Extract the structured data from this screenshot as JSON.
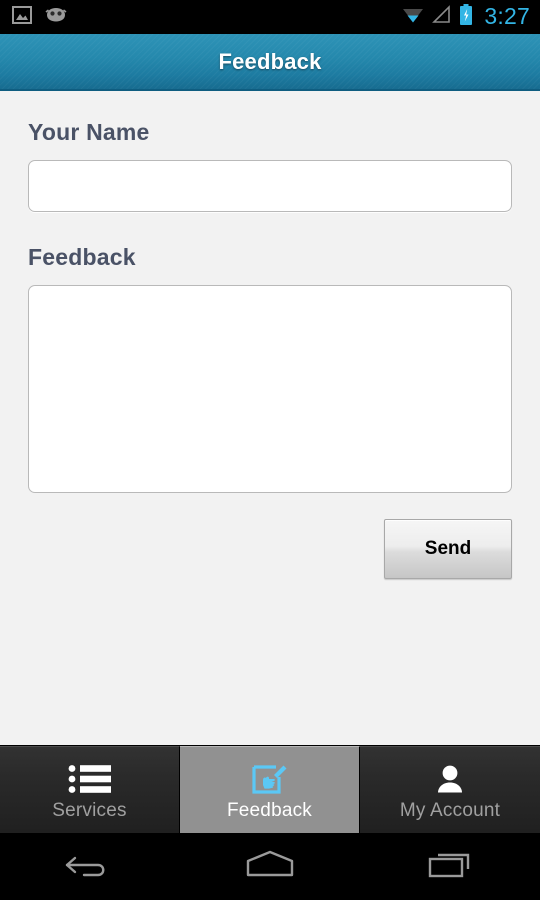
{
  "statusbar": {
    "icons_left": [
      {
        "name": "screenshot-image-icon",
        "label": "screenshot"
      },
      {
        "name": "cyanogenmod-android-icon",
        "label": "cyanogenmod"
      }
    ],
    "icons_right": [
      {
        "name": "wifi-icon",
        "label": "wifi"
      },
      {
        "name": "signal-icon",
        "label": "cellular-signal"
      },
      {
        "name": "battery-charging-icon",
        "label": "battery-charging"
      }
    ],
    "clock": "3:27",
    "clock_color": "#33b5e5"
  },
  "actionbar": {
    "title": "Feedback",
    "background_color": "#2589ad",
    "title_color": "#ffffff"
  },
  "form": {
    "name": {
      "label": "Your Name",
      "value": "",
      "placeholder": ""
    },
    "feedback": {
      "label": "Feedback",
      "value": "",
      "placeholder": ""
    },
    "send_button": {
      "label": "Send"
    },
    "label_color": "#4a5266",
    "field_border_color": "#b9b9b9",
    "page_background": "#f2f2f2"
  },
  "tabbar": {
    "selected_index": 1,
    "selected_background": "#919191",
    "accent_color": "#5bc8f5",
    "tabs": [
      {
        "label": "Services",
        "icon": "list-icon",
        "selected": false
      },
      {
        "label": "Feedback",
        "icon": "compose-edit-icon",
        "selected": true
      },
      {
        "label": "My Account",
        "icon": "person-icon",
        "selected": false
      }
    ]
  },
  "navbar": {
    "buttons": [
      {
        "label": "Back",
        "icon": "back-arrow-icon"
      },
      {
        "label": "Home",
        "icon": "home-icon"
      },
      {
        "label": "Recents",
        "icon": "recents-icon"
      }
    ],
    "icon_color": "#9a9a9a"
  }
}
